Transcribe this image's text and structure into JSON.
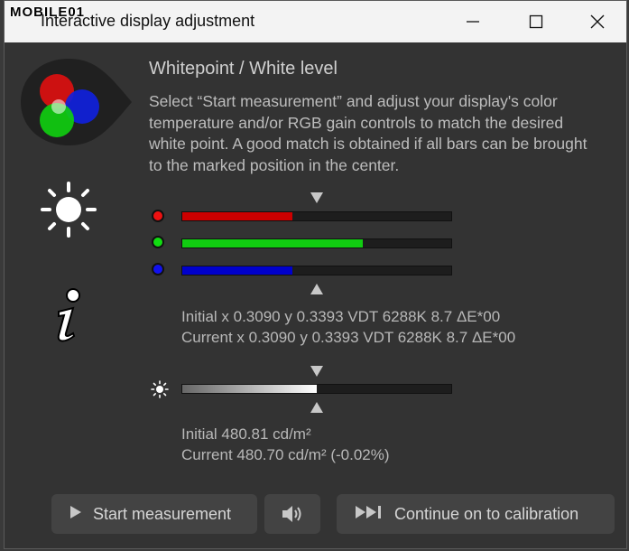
{
  "window": {
    "title": "Interactive display adjustment",
    "watermark": "MOBILE01"
  },
  "heading": "Whitepoint / White level",
  "description": "Select “Start measurement” and adjust your display's color temperature and/or RGB gain controls to match the desired white point. A good match is obtained if all bars can be brought to the marked position in the center.",
  "rgb_bars": [
    {
      "name": "red",
      "color": "#cc0000",
      "level": 0.41
    },
    {
      "name": "green",
      "color": "#11cc11",
      "level": 0.67
    },
    {
      "name": "blue",
      "color": "#0000cc",
      "level": 0.41
    }
  ],
  "measurement": {
    "initial": "Initial x 0.3090 y 0.3393 VDT 6288K 8.7 ΔE*00",
    "current": "Current x 0.3090 y 0.3393 VDT 6288K 8.7 ΔE*00"
  },
  "luminance": {
    "level": 0.5,
    "initial": "Initial 480.81 cd/m²",
    "current": "Current 480.70 cd/m² (-0.02%)"
  },
  "buttons": {
    "start": "Start measurement",
    "continue": "Continue on to calibration"
  }
}
